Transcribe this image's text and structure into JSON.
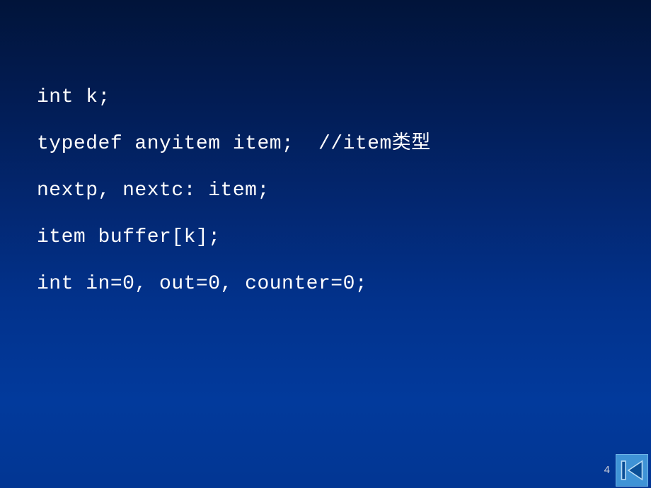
{
  "slide": {
    "background_top_color": "#01143a",
    "background_bottom_color": "#023693",
    "text_color": "#ffffff",
    "code_lines": [
      {
        "text": "int k;",
        "comment": "",
        "comment_cjk": ""
      },
      {
        "text": "typedef anyitem item;",
        "comment": "  //item",
        "comment_cjk": "类型"
      },
      {
        "text": "nextp, nextc: item;",
        "comment": "",
        "comment_cjk": ""
      },
      {
        "text": "item buffer[k];",
        "comment": "",
        "comment_cjk": ""
      },
      {
        "text": "int in=0, out=0, counter=0;",
        "comment": "",
        "comment_cjk": ""
      }
    ]
  },
  "footer": {
    "page_number": "4",
    "nav_prev": {
      "icon": "skip-to-previous-icon",
      "label": "Previous slide",
      "background_color": "#3f93d6",
      "border_color": "#6fb4e8",
      "glyph_color": "#0b4f97"
    }
  }
}
